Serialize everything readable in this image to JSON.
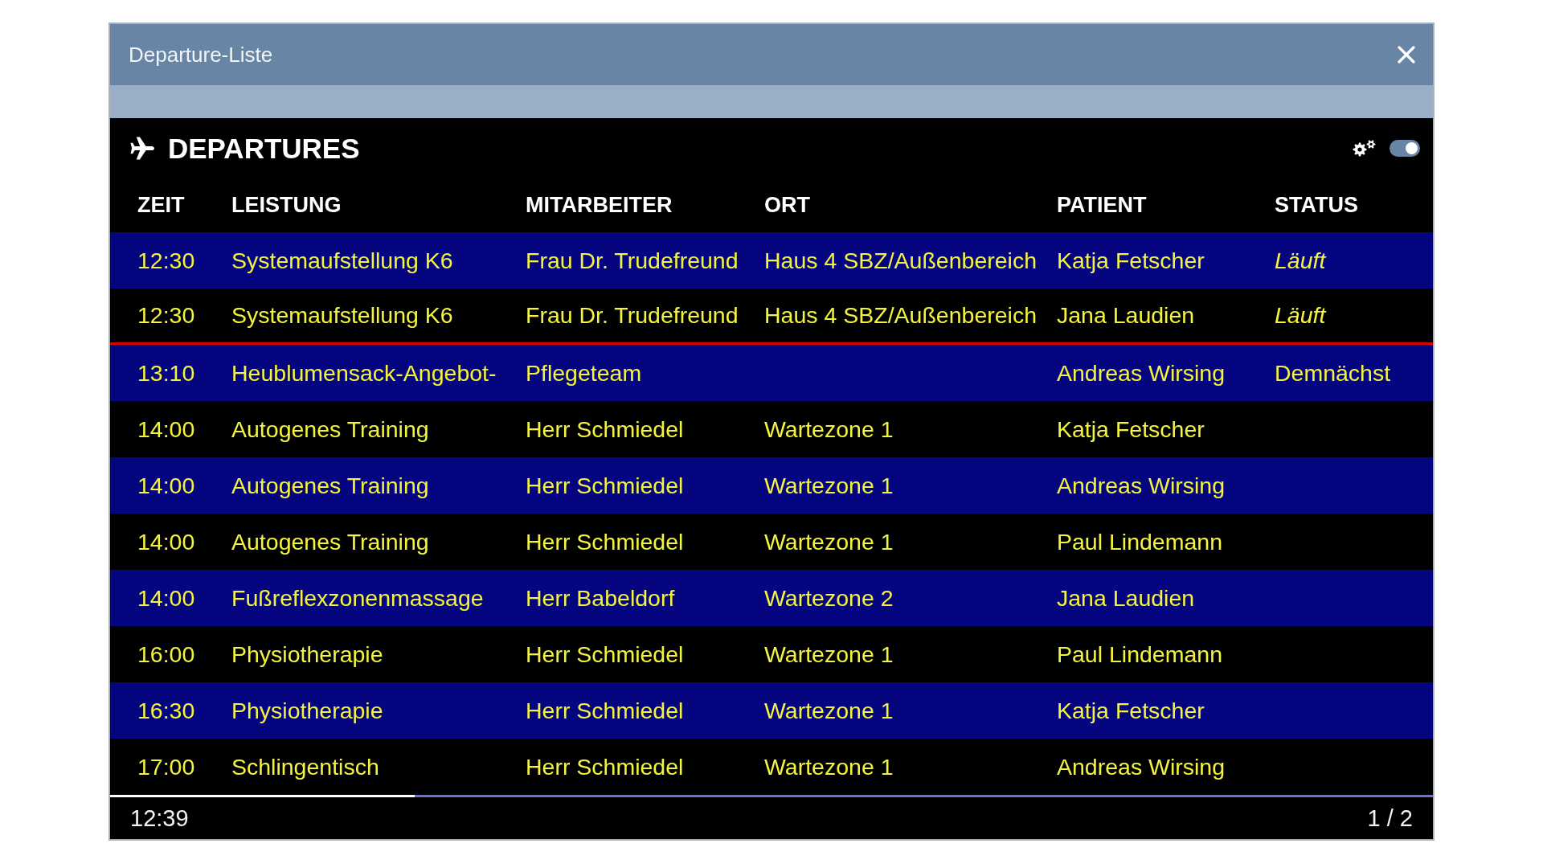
{
  "window": {
    "title": "Departure-Liste"
  },
  "header": {
    "title": "DEPARTURES",
    "toggle": {
      "on": true
    }
  },
  "columns": [
    "ZEIT",
    "LEISTUNG",
    "MITARBEITER",
    "ORT",
    "PATIENT",
    "STATUS"
  ],
  "rows": [
    {
      "time": "12:30",
      "service": "Systemaufstellung K6",
      "staff": "Frau Dr. Trudefreund",
      "location": "Haus 4 SBZ/Außenbereich",
      "patient": "Katja Fetscher",
      "status": "Läuft",
      "running": true,
      "now_line_below": false
    },
    {
      "time": "12:30",
      "service": "Systemaufstellung K6",
      "staff": "Frau Dr. Trudefreund",
      "location": "Haus 4 SBZ/Außenbereich",
      "patient": "Jana Laudien",
      "status": "Läuft",
      "running": true,
      "now_line_below": true
    },
    {
      "time": "13:10",
      "service": "Heublumensack-Angebot-",
      "staff": "Pflegeteam",
      "patient": "Andreas Wirsing",
      "status": "Demnächst",
      "running": false,
      "now_line_below": false
    },
    {
      "time": "14:00",
      "service": "Autogenes Training",
      "staff": "Herr Schmiedel",
      "location": "Wartezone 1",
      "patient": "Katja Fetscher",
      "now_line_below": false
    },
    {
      "time": "14:00",
      "service": "Autogenes Training",
      "staff": "Herr Schmiedel",
      "location": "Wartezone 1",
      "patient": "Andreas Wirsing",
      "now_line_below": false
    },
    {
      "time": "14:00",
      "service": "Autogenes Training",
      "staff": "Herr Schmiedel",
      "location": "Wartezone 1",
      "patient": "Paul Lindemann",
      "now_line_below": false
    },
    {
      "time": "14:00",
      "service": "Fußreflexzonenmassage",
      "staff": "Herr Babeldorf",
      "location": "Wartezone 2",
      "patient": "Jana Laudien",
      "now_line_below": false
    },
    {
      "time": "16:00",
      "service": "Physiotherapie",
      "staff": "Herr Schmiedel",
      "location": "Wartezone 1",
      "patient": "Paul Lindemann",
      "now_line_below": false
    },
    {
      "time": "16:30",
      "service": "Physiotherapie",
      "staff": "Herr Schmiedel",
      "location": "Wartezone 1",
      "patient": "Katja Fetscher",
      "now_line_below": false
    },
    {
      "time": "17:00",
      "service": "Schlingentisch",
      "staff": "Herr Schmiedel",
      "location": "Wartezone 1",
      "patient": "Andreas Wirsing",
      "now_line_below": false
    }
  ],
  "footer": {
    "clock": "12:39",
    "page": "1 / 2",
    "progress": {
      "level": 0.23
    }
  }
}
